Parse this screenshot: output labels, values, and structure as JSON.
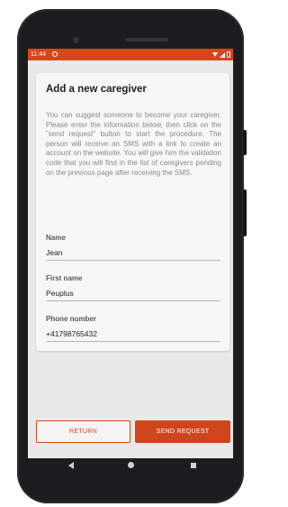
{
  "status_bar": {
    "time": "11:44",
    "icons": [
      "app-notification-icon",
      "wifi-icon",
      "signal-icon",
      "battery-icon"
    ],
    "color": "#d7461b"
  },
  "card": {
    "title": "Add a new caregiver",
    "description": "You can suggest someone to become your caregiver. Please enter the information below, then click on the \"send request\" button to start the procedure. The person will receive an SMS with a link to create an account on the website. You will give him the validation code that you will find in the list of caregivers pending on the previous page after receiving the SMS."
  },
  "fields": [
    {
      "label": "Name",
      "value": "Jean"
    },
    {
      "label": "First name",
      "value": "Peuplus"
    },
    {
      "label": "Phone number",
      "value": "+41798765432"
    }
  ],
  "actions": {
    "return_label": "RETURN",
    "send_label": "SEND REQUEST"
  },
  "navigation": {
    "icons": [
      "back-icon",
      "home-icon",
      "recents-icon"
    ]
  },
  "colors": {
    "accent": "#d0451b",
    "background": "#e9e9e9"
  }
}
